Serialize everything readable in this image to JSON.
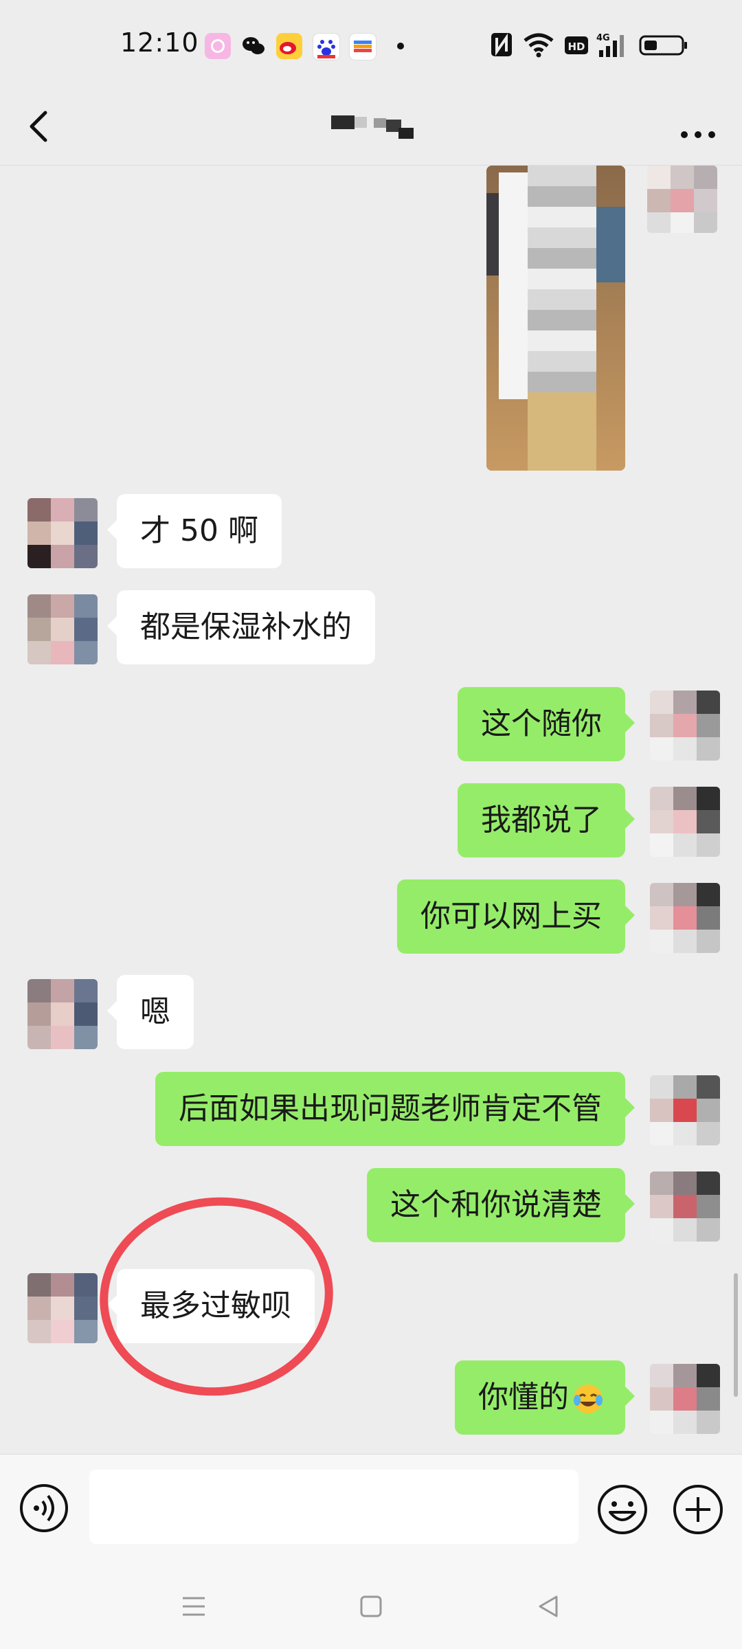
{
  "status_bar": {
    "time": "12:10",
    "app_icons": [
      "camera-app-icon",
      "wechat-icon",
      "weibo-icon",
      "baidu-icon",
      "wallet-icon"
    ],
    "indicators": [
      "nfc-icon",
      "wifi-icon",
      "hd-icon",
      "4g-signal-icon",
      "battery-icon"
    ]
  },
  "nav": {
    "back_icon": "chevron-left-icon",
    "more_icon": "more-dots-icon"
  },
  "messages": [
    {
      "side": "right",
      "type": "image"
    },
    {
      "side": "left",
      "text": "才 50 啊"
    },
    {
      "side": "left",
      "text": "都是保湿补水的"
    },
    {
      "side": "right",
      "text": "这个随你"
    },
    {
      "side": "right",
      "text": "我都说了"
    },
    {
      "side": "right",
      "text": "你可以网上买"
    },
    {
      "side": "left",
      "text": "嗯"
    },
    {
      "side": "right",
      "text": "后面如果出现问题老师肯定不管"
    },
    {
      "side": "right",
      "text": "这个和你说清楚"
    },
    {
      "side": "left",
      "text": "最多过敏呗",
      "annotation": "red-circle"
    },
    {
      "side": "right",
      "text": "你懂的",
      "emoji": "laughing-crying-emoji"
    }
  ],
  "input_bar": {
    "voice_icon": "voice-icon",
    "text_value": "",
    "emoji_icon": "emoji-icon",
    "plus_icon": "plus-icon"
  },
  "system_nav": [
    "menu-icon",
    "home-icon",
    "back-triangle-icon"
  ],
  "colors": {
    "background": "#ededed",
    "bubble_sent": "#95ec69",
    "bubble_received": "#ffffff",
    "annotation_circle": "#ee4b55"
  }
}
